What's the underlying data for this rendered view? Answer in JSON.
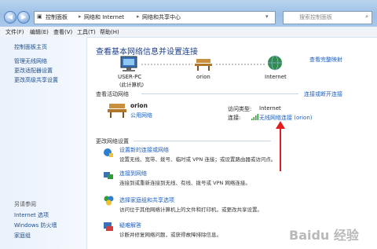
{
  "address": {
    "crumbs": [
      "控制面板",
      "网络和 Internet",
      "网络和共享中心"
    ],
    "search_placeholder": "搜索控制面板"
  },
  "menu": [
    "文件(F)",
    "编辑(E)",
    "查看(V)",
    "工具(T)",
    "帮助(H)"
  ],
  "sidebar": {
    "home": "控制面板主页",
    "items": [
      "管理无线网络",
      "更改适配器设置",
      "更改高级共享设置"
    ],
    "see_also_title": "另请参阅",
    "see_also": [
      "Internet 选项",
      "Windows 防火墙",
      "家庭组"
    ]
  },
  "main": {
    "title": "查看基本网络信息并设置连接",
    "full_map": "查看完整映射",
    "map": {
      "pc_name": "USER-PC",
      "pc_sub": "(此计算机)",
      "network": "orion",
      "internet": "Internet"
    },
    "active_title": "查看活动网络",
    "connect_disconnect": "连接或断开连接",
    "active_network": {
      "name": "orion",
      "type": "公用网络",
      "access_label": "访问类型:",
      "access_value": "Internet",
      "conn_label": "连接:",
      "conn_value": "无线网络连接 (orion)"
    },
    "change_title": "更改网络设置",
    "tasks": [
      {
        "title": "设置新的连接或网络",
        "desc": "设置无线、宽带、拨号、临时或 VPN 连接；或设置路由器或访问点。"
      },
      {
        "title": "连接到网络",
        "desc": "连接到或重新连接到无线、有线、拨号或 VPN 网络连接。"
      },
      {
        "title": "选择家庭组和共享选项",
        "desc": "访问位于其他网络计算机上的文件和打印机，或更改共享设置。"
      },
      {
        "title": "疑难解答",
        "desc": "诊断并修复网络问题，或获得故障排除信息。"
      }
    ]
  },
  "watermark": "Baidu 经验"
}
